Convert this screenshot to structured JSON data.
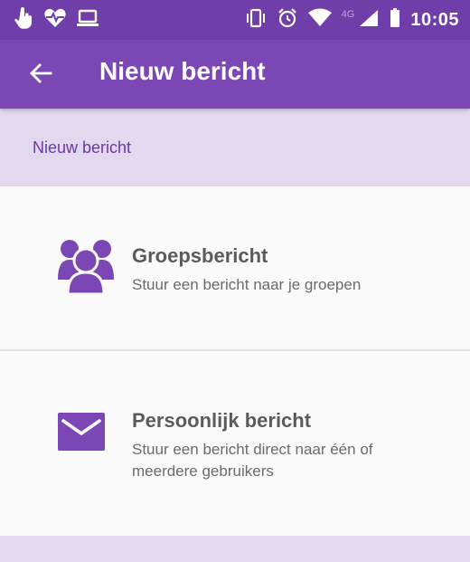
{
  "status_bar": {
    "time": "10:05",
    "network_label": "4G",
    "left_icons": [
      "touch-hand-icon",
      "heart-pulse-icon",
      "laptop-icon"
    ],
    "right_icons": [
      "vibrate-icon",
      "alarm-icon",
      "wifi-icon",
      "signal-icon",
      "battery-icon"
    ]
  },
  "app_bar": {
    "title": "Nieuw bericht",
    "back_icon": "arrow-left-icon"
  },
  "section": {
    "header": "Nieuw bericht"
  },
  "options": [
    {
      "title": "Groepsbericht",
      "description": "Stuur een bericht naar je groepen",
      "icon": "group-icon"
    },
    {
      "title": "Persoonlijk bericht",
      "description": "Stuur een bericht direct naar één of meerdere gebruikers",
      "icon": "envelope-icon"
    }
  ],
  "colors": {
    "status_bar": "#6f3ea8",
    "app_bar": "#7b47b4",
    "section_header_bg": "#e2d9ee",
    "accent": "#7b47b4",
    "title_text": "#5b5b5b",
    "body_text": "#6b6b6b"
  }
}
